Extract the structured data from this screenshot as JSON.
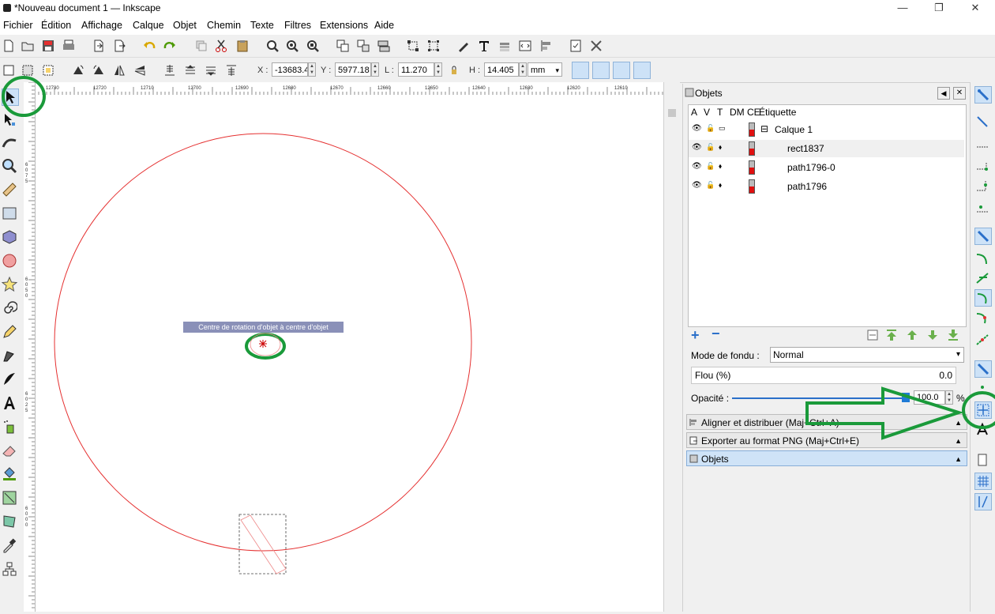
{
  "window": {
    "title": "*Nouveau document 1 — Inkscape",
    "controls": [
      "—",
      "❐",
      "✕"
    ]
  },
  "menubar": {
    "items": [
      {
        "label": "Fichier",
        "accel": "F"
      },
      {
        "label": "Édition",
        "accel": "É"
      },
      {
        "label": "Affichage",
        "accel": "A"
      },
      {
        "label": "Calque",
        "accel": "C"
      },
      {
        "label": "Objet",
        "accel": "O"
      },
      {
        "label": "Chemin",
        "accel": "C"
      },
      {
        "label": "Texte",
        "accel": "T"
      },
      {
        "label": "Filtres",
        "accel": "F"
      },
      {
        "label": "Extensions",
        "accel": "x"
      },
      {
        "label": "Aide",
        "accel": "d"
      }
    ]
  },
  "toolcontrols": {
    "x_label": "X :",
    "x_value": "-13683.4",
    "y_label": "Y :",
    "y_value": "5977.18",
    "w_label": "L :",
    "w_value": "11.270",
    "h_label": "H :",
    "h_value": "14.405",
    "unit": "mm"
  },
  "ruler": {
    "marks": [
      "12730",
      "12720",
      "12710",
      "12700",
      "12690",
      "12680",
      "12670",
      "12660",
      "12650",
      "12640",
      "12630",
      "12620",
      "12610"
    ],
    "vmarks": [
      "6075",
      "6050",
      "6025",
      "6000",
      "5975"
    ]
  },
  "canvas": {
    "tooltip": "Centre de rotation d'objet à centre d'objet"
  },
  "objects_panel": {
    "title": "Objets",
    "columns": [
      "A",
      "V",
      "T",
      "DM",
      "CE",
      "Étiquette"
    ],
    "rows": [
      {
        "label": "Calque 1",
        "indent": 0,
        "expander": "⊟"
      },
      {
        "label": "rect1837",
        "indent": 1
      },
      {
        "label": "path1796-0",
        "indent": 1
      },
      {
        "label": "path1796",
        "indent": 1
      }
    ],
    "blend_label": "Mode de fondu :",
    "blend_value": "Normal",
    "blur_label": "Flou (%)",
    "blur_value": "0.0",
    "opacity_label": "Opacité :",
    "opacity_value": "100.0",
    "opacity_unit": "%",
    "opacity_level": 1.0
  },
  "docked_panels": [
    {
      "label": "Aligner et distribuer (Maj+Ctrl+A)",
      "arrow": "▲"
    },
    {
      "label": "Exporter au format PNG (Maj+Ctrl+E)",
      "arrow": "▲"
    },
    {
      "label": "Objets",
      "arrow": "▲"
    }
  ],
  "colors": {
    "accent": "#cde2f7",
    "highlight": "#1a9a3a",
    "circle": "#e53030",
    "layer_red": "#e01010"
  }
}
